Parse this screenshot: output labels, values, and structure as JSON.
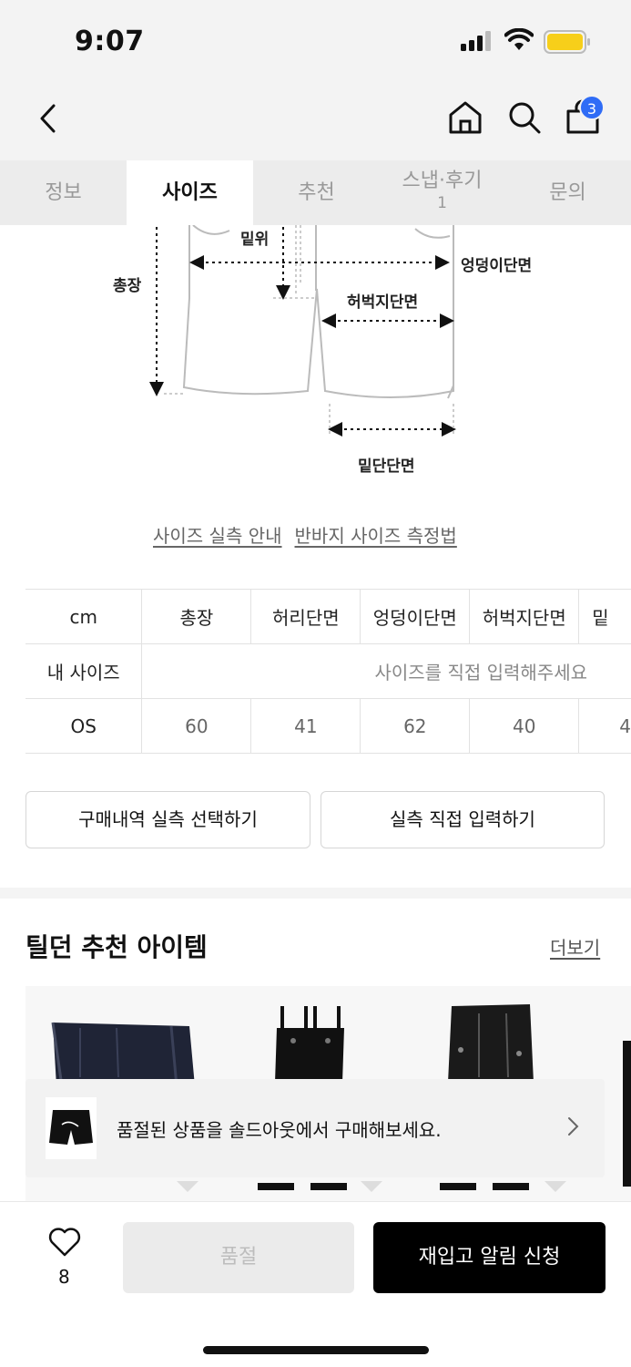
{
  "status": {
    "time": "9:07"
  },
  "header": {
    "cart_count": "3"
  },
  "tabs": [
    {
      "label": "정보"
    },
    {
      "label": "사이즈"
    },
    {
      "label": "추천"
    },
    {
      "label": "스냅·후기",
      "count": "1"
    },
    {
      "label": "문의"
    }
  ],
  "diagram": {
    "labels": {
      "total_length": "총장",
      "rise": "밑위",
      "hip": "엉덩이단면",
      "thigh": "허벅지단면",
      "hem": "밑단단면"
    }
  },
  "links": {
    "guide": "사이즈 실측 안내",
    "howto": "반바지 사이즈 측정법"
  },
  "size_table": {
    "unit": "cm",
    "columns": [
      "총장",
      "허리단면",
      "엉덩이단면",
      "허벅지단면",
      "밑"
    ],
    "my_size_label": "내 사이즈",
    "my_size_placeholder": "사이즈를 직접 입력해주세요",
    "rows": [
      {
        "name": "OS",
        "values": [
          "60",
          "41",
          "62",
          "40",
          "4"
        ]
      }
    ]
  },
  "buttons": {
    "history": "구매내역 실측 선택하기",
    "manual": "실측 직접 입력하기"
  },
  "recommend": {
    "title": "틸던 추천 아이템",
    "more": "더보기"
  },
  "soldout_banner": {
    "message": "품절된 상품을 솔드아웃에서 구매해보세요."
  },
  "bottom": {
    "like_count": "8",
    "soldout_label": "품절",
    "restock_label": "재입고 알림 신청"
  }
}
